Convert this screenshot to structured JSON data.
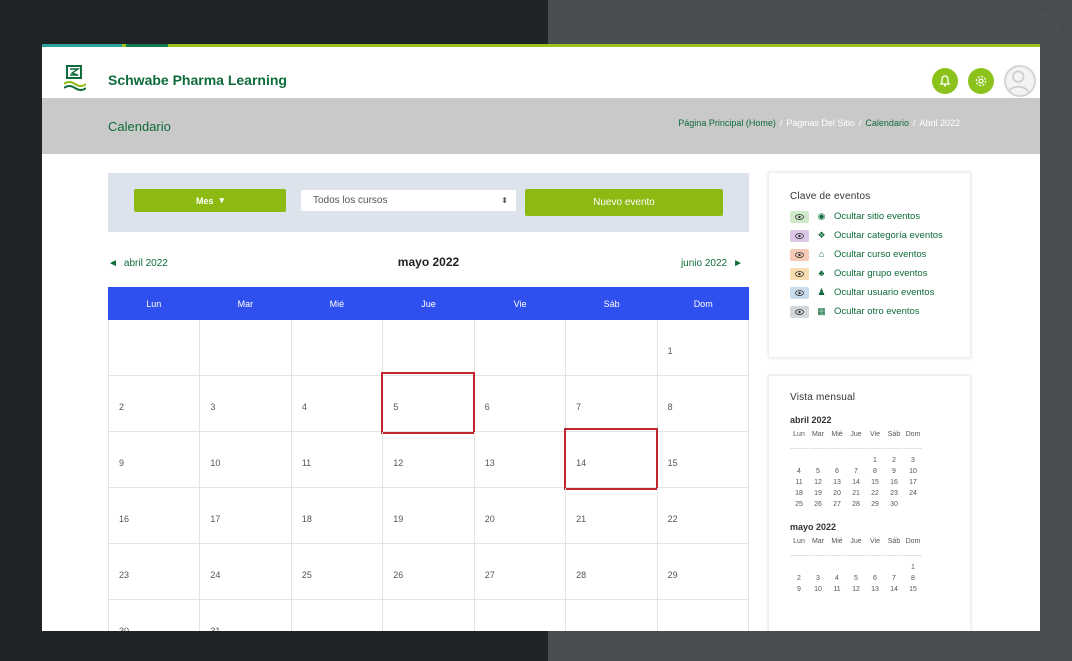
{
  "app": {
    "brand": "Schwabe Pharma Learning"
  },
  "header": {
    "page_title": "Calendario",
    "breadcrumb": [
      {
        "label": "Página Principal (Home)",
        "tone": "green"
      },
      {
        "label": "Páginas Del Sitio",
        "tone": "light"
      },
      {
        "label": "Calendario",
        "tone": "green"
      },
      {
        "label": "Abril 2022",
        "tone": "light"
      }
    ],
    "breadcrumb_separator": "/"
  },
  "toolbar": {
    "view_button": "Mes",
    "course_select_value": "Todos los cursos",
    "new_event_button": "Nuevo evento"
  },
  "month_nav": {
    "prev": "abril 2022",
    "current": "mayo 2022",
    "next": "junio 2022"
  },
  "calendar": {
    "weekdays": [
      "Lun",
      "Mar",
      "Mié",
      "Jue",
      "Vie",
      "Sáb",
      "Dom"
    ],
    "weeks": [
      [
        "",
        "",
        "",
        "",
        "",
        "",
        "1"
      ],
      [
        "2",
        "3",
        "4",
        "5",
        "6",
        "7",
        "8"
      ],
      [
        "9",
        "10",
        "11",
        "12",
        "13",
        "14",
        "15"
      ],
      [
        "16",
        "17",
        "18",
        "19",
        "20",
        "21",
        "22"
      ],
      [
        "23",
        "24",
        "25",
        "26",
        "27",
        "28",
        "29"
      ],
      [
        "30",
        "31",
        "",
        "",
        "",
        "",
        ""
      ]
    ],
    "highlighted_days": [
      "5",
      "14"
    ],
    "highlight_color": "#c0262d",
    "header_color": "#2f50ee"
  },
  "event_keys": {
    "title": "Clave de eventos",
    "items": [
      {
        "label": "Ocultar sitio eventos",
        "icon": "globe-icon",
        "color": "#cfe9c9"
      },
      {
        "label": "Ocultar categoría eventos",
        "icon": "cubes-icon",
        "color": "#dcc8e6"
      },
      {
        "label": "Ocultar curso eventos",
        "icon": "graduation-cap-icon",
        "color": "#f4c9b6"
      },
      {
        "label": "Ocultar grupo eventos",
        "icon": "users-icon",
        "color": "#f7ddb0"
      },
      {
        "label": "Ocultar usuario eventos",
        "icon": "user-icon",
        "color": "#c9dcec"
      },
      {
        "label": "Ocultar otro eventos",
        "icon": "calendar-icon",
        "color": "#d2d6dd"
      }
    ]
  },
  "mini_calendar": {
    "title": "Vista mensual",
    "weekdays": [
      "Lun",
      "Mar",
      "Mié",
      "Jue",
      "Vie",
      "Sáb",
      "Dom"
    ],
    "months": [
      {
        "label": "abril 2022",
        "weeks": [
          [
            "",
            "",
            "",
            "",
            "1",
            "2",
            "3"
          ],
          [
            "4",
            "5",
            "6",
            "7",
            "8",
            "9",
            "10"
          ],
          [
            "11",
            "12",
            "13",
            "14",
            "15",
            "16",
            "17"
          ],
          [
            "18",
            "19",
            "20",
            "21",
            "22",
            "23",
            "24"
          ],
          [
            "25",
            "26",
            "27",
            "28",
            "29",
            "30",
            ""
          ]
        ]
      },
      {
        "label": "mayo 2022",
        "weeks": [
          [
            "",
            "",
            "",
            "",
            "",
            "",
            "1"
          ],
          [
            "2",
            "3",
            "4",
            "5",
            "6",
            "7",
            "8"
          ],
          [
            "9",
            "10",
            "11",
            "12",
            "13",
            "14",
            "15"
          ]
        ]
      }
    ]
  },
  "colors": {
    "brand_green": "#0e6b3b",
    "accent_green": "#8cba12"
  }
}
